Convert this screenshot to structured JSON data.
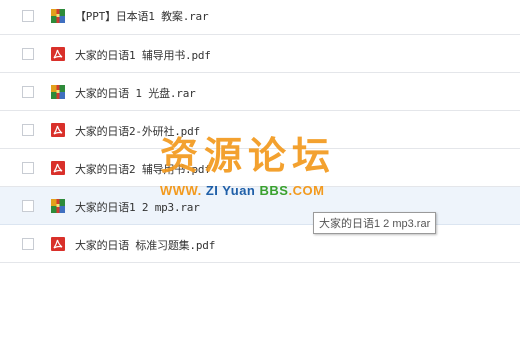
{
  "files": [
    {
      "name": "【PPT】日本语1 教案.rar",
      "type": "rar-archive-icon"
    },
    {
      "name": "大家的日语1 辅导用书.pdf",
      "type": "pdf-file-icon"
    },
    {
      "name": "大家的日语 1 光盘.rar",
      "type": "rar-archive-icon"
    },
    {
      "name": "大家的日语2-外研社.pdf",
      "type": "pdf-file-icon"
    },
    {
      "name": "大家的日语2 辅导用书.pdf",
      "type": "pdf-file-icon"
    },
    {
      "name": "大家的日语1 2 mp3.rar",
      "type": "rar-archive-icon"
    },
    {
      "name": "大家的日语 标准习题集.pdf",
      "type": "pdf-file-icon"
    }
  ],
  "watermark": {
    "chinese": "资源论坛",
    "www": "WWW.",
    "zi": "ZI",
    "yuan": "Yuan",
    "bbs": "BBS",
    "com": ".COM"
  },
  "tooltip": {
    "text": "大家的日语1 2 mp3.rar"
  },
  "colors": {
    "pdf": "#d9302a",
    "watermark_orange": "#f39a1e",
    "watermark_blue": "#1f5fa8",
    "watermark_green": "#3aa12e"
  }
}
